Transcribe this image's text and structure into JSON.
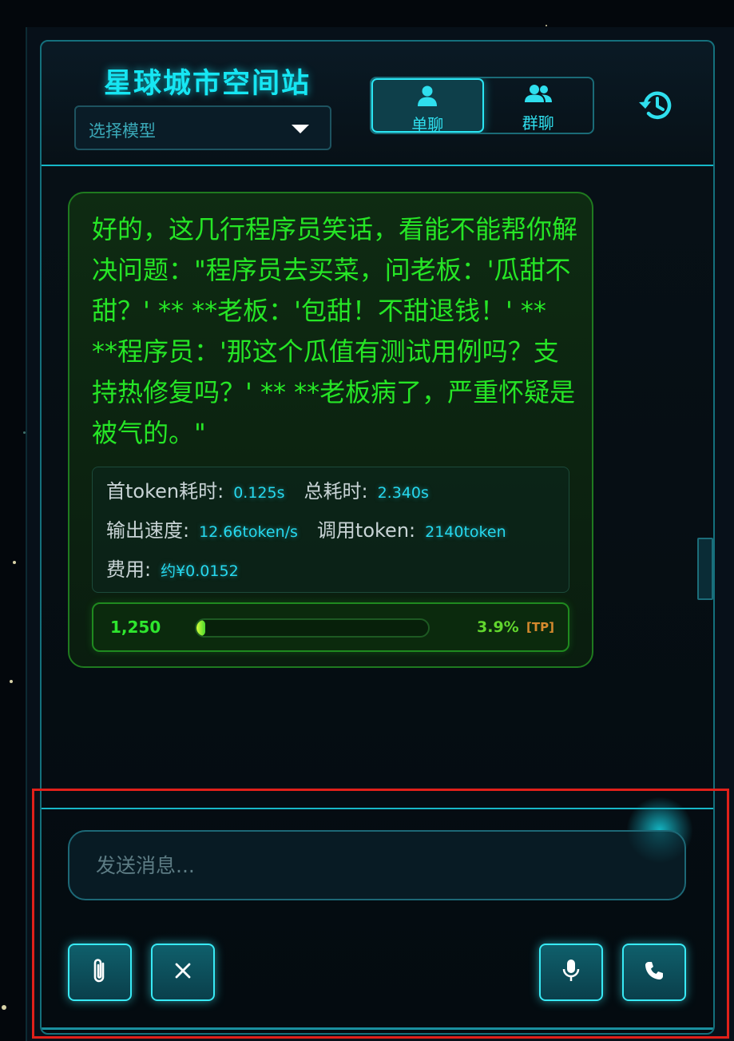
{
  "header": {
    "title": "星球城市空间站",
    "model_select": {
      "label": "选择模型"
    },
    "modes": [
      {
        "label": "单聊",
        "icon": "user-icon",
        "active": true
      },
      {
        "label": "群聊",
        "icon": "group-icon",
        "active": false
      }
    ],
    "history_icon": "history-icon"
  },
  "message": {
    "text": "好的，这几行程序员笑话，看能不能帮你解决问题：\"程序员去买菜，问老板：'瓜甜不甜？' ** **老板：'包甜！不甜退钱！' ** **程序员：'那这个瓜值有测试用例吗？支持热修复吗？' ** **老板病了，严重怀疑是被气的。\"",
    "stats": {
      "first_token_label": "首token耗时:",
      "first_token_value": "0.125s",
      "total_time_label": "总耗时:",
      "total_time_value": "2.340s",
      "speed_label": "输出速度:",
      "speed_value": "12.66token/s",
      "tokens_used_label": "调用token:",
      "tokens_used_value": "2140token",
      "cost_label": "费用:",
      "cost_value": "约¥0.0152"
    },
    "token_bar": {
      "count": "1,250",
      "percent_text": "3.9%",
      "progress_fraction": 0.039,
      "tag": "[TP]"
    }
  },
  "composer": {
    "placeholder": "发送消息...",
    "buttons": [
      {
        "icon": "paperclip-icon"
      },
      {
        "icon": "close-icon"
      },
      {
        "icon": "microphone-icon"
      },
      {
        "icon": "phone-icon"
      }
    ]
  },
  "colors": {
    "accent_cyan": "#16e6f3",
    "message_green": "#26e626",
    "stat_value_cyan": "#26d8ee",
    "tag_orange": "#d68a2e",
    "highlight_red": "#e1201a"
  }
}
